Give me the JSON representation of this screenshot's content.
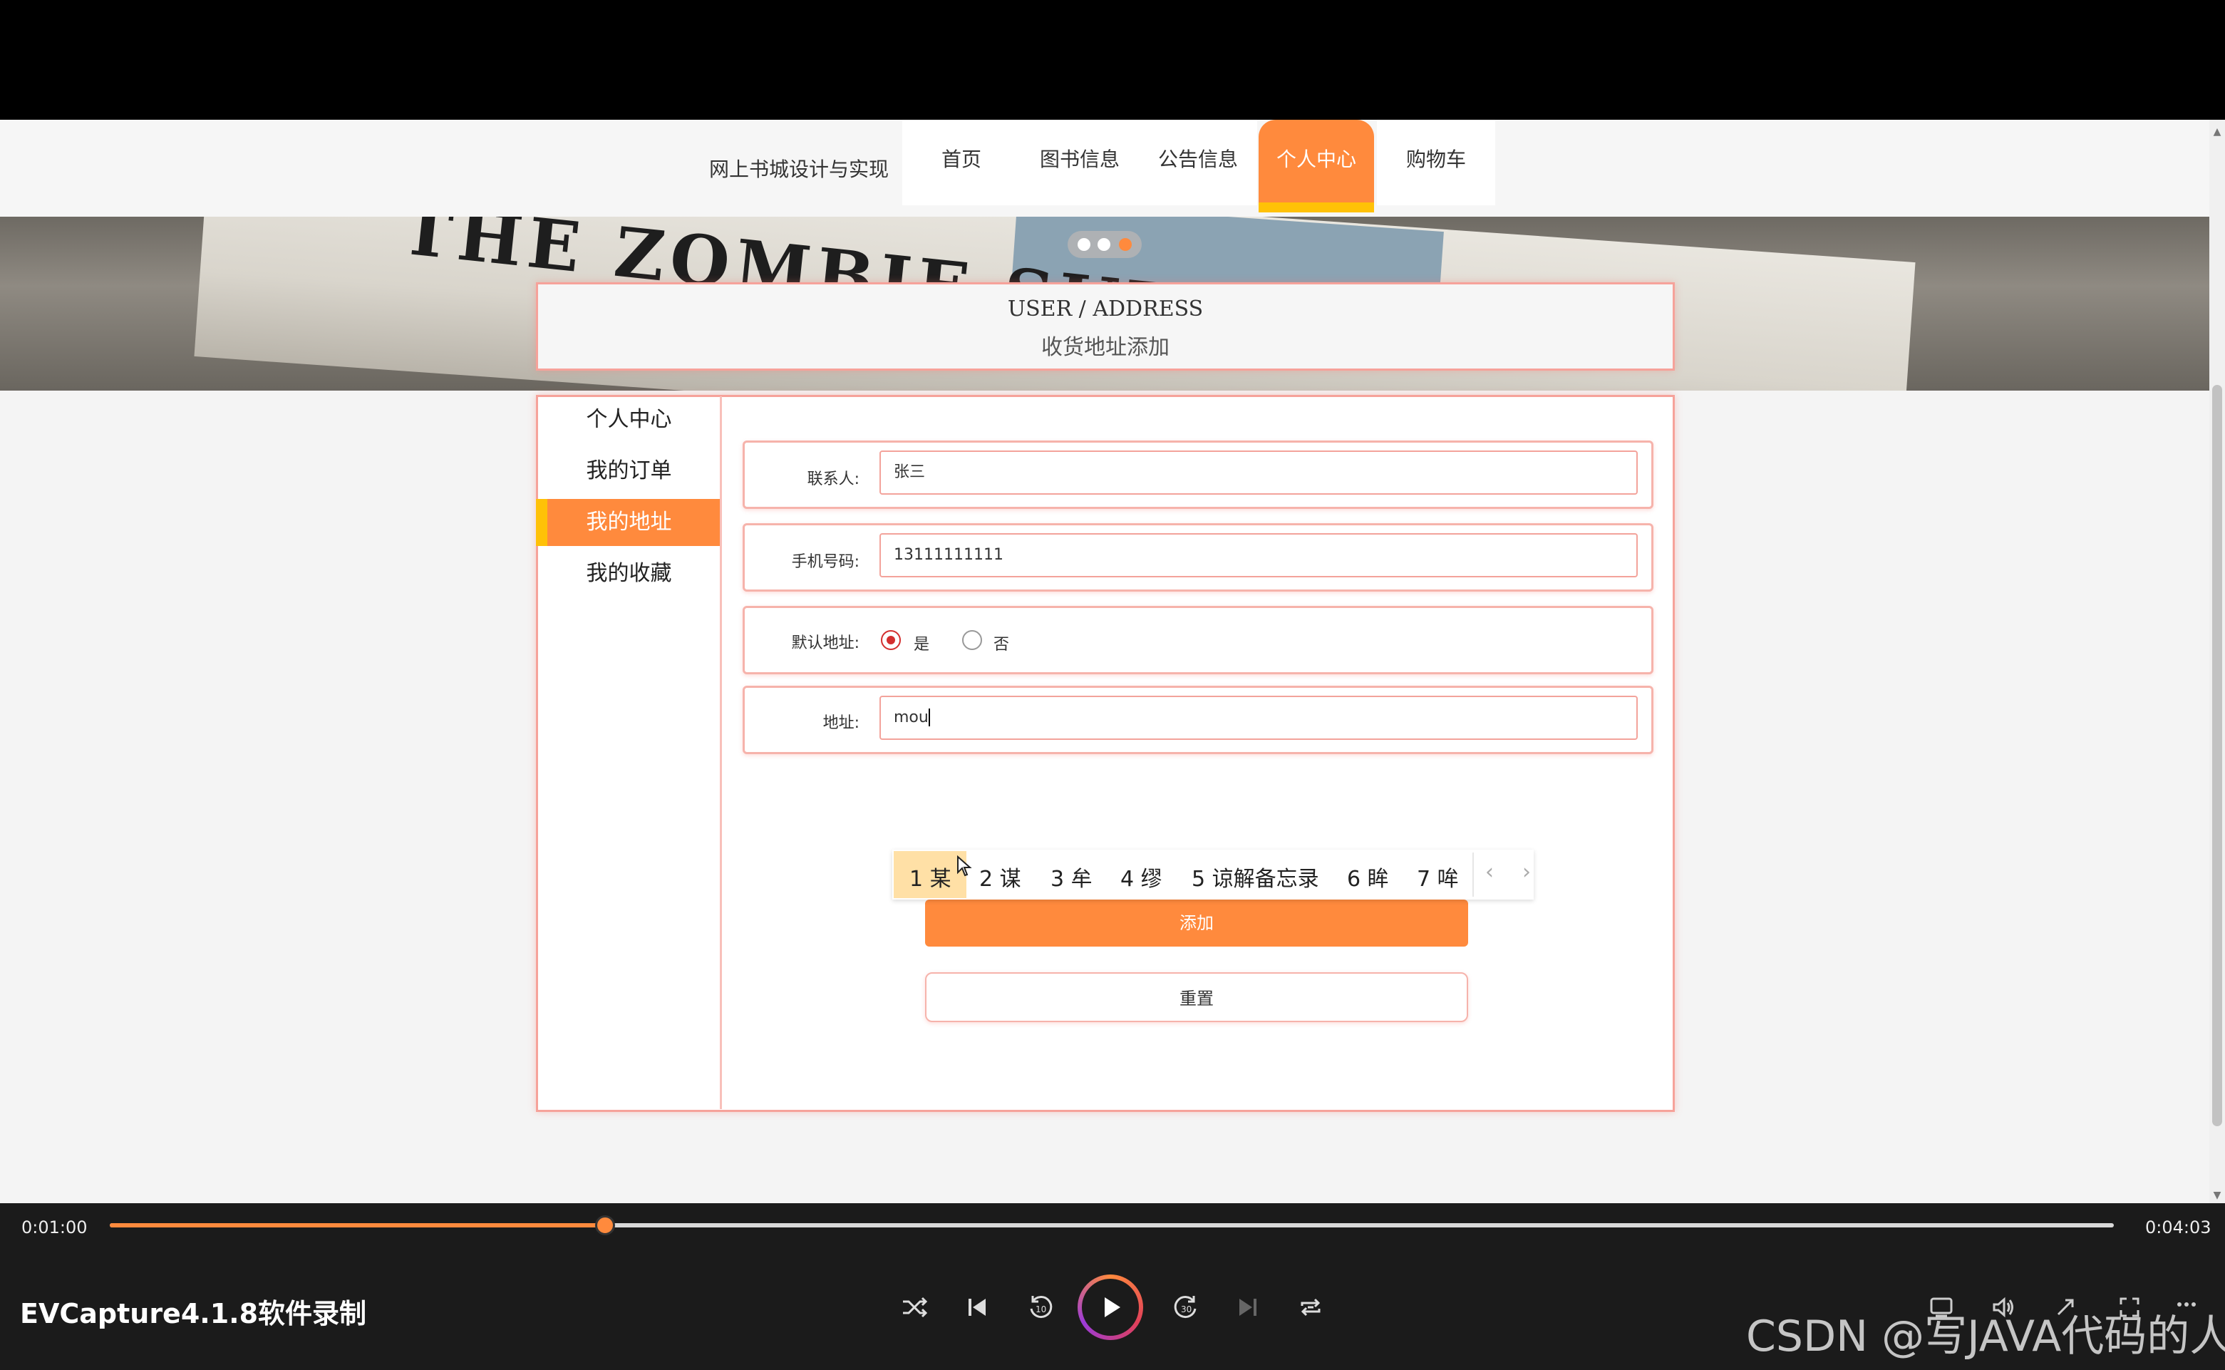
{
  "header": {
    "site_title": "网上书城设计与实现",
    "nav": {
      "home": "首页",
      "books": "图书信息",
      "notice": "公告信息",
      "personal": "个人中心",
      "cart": "购物车"
    }
  },
  "banner": {
    "text": "THE ZOMBIE SURVIV"
  },
  "title_box": {
    "en": "USER / ADDRESS",
    "cn": "收货地址添加"
  },
  "sidebar": {
    "items": [
      {
        "label": "个人中心"
      },
      {
        "label": "我的订单"
      },
      {
        "label": "我的地址"
      },
      {
        "label": "我的收藏"
      }
    ]
  },
  "form": {
    "contact_label": "联系人:",
    "contact_value": "张三",
    "phone_label": "手机号码:",
    "phone_value": "13111111111",
    "default_label": "默认地址:",
    "default_yes": "是",
    "default_no": "否",
    "default_selected": "是",
    "address_label": "地址:",
    "address_value": "mou",
    "add_button": "添加",
    "reset_button": "重置"
  },
  "ime": {
    "candidates": [
      "1 某",
      "2 谋",
      "3 牟",
      "4 缪",
      "5 谅解备忘录",
      "6 眸",
      "7 哞"
    ],
    "prev": "‹",
    "next": "›"
  },
  "player": {
    "current_time": "0:01:00",
    "total_time": "0:04:03",
    "progress_fraction": 0.247,
    "app_name": "EVCapture4.1.8软件录制",
    "watermark": "CSDN @写JAVA代码的人",
    "accent": "#ff8a3d"
  },
  "icons": {
    "shuffle": "shuffle-icon",
    "prev": "skip-previous-icon",
    "back10": "rewind-10-icon",
    "play": "play-icon",
    "fwd30": "forward-30-icon",
    "next": "skip-next-icon",
    "repeat": "repeat-icon",
    "subtitle": "subtitle-icon",
    "volume": "volume-icon",
    "expand": "expand-icon",
    "fullscreen": "fullscreen-icon",
    "more": "more-icon"
  },
  "colors": {
    "accent": "#ff8a3d",
    "highlight": "#ffc107",
    "border": "#f6a29a"
  }
}
